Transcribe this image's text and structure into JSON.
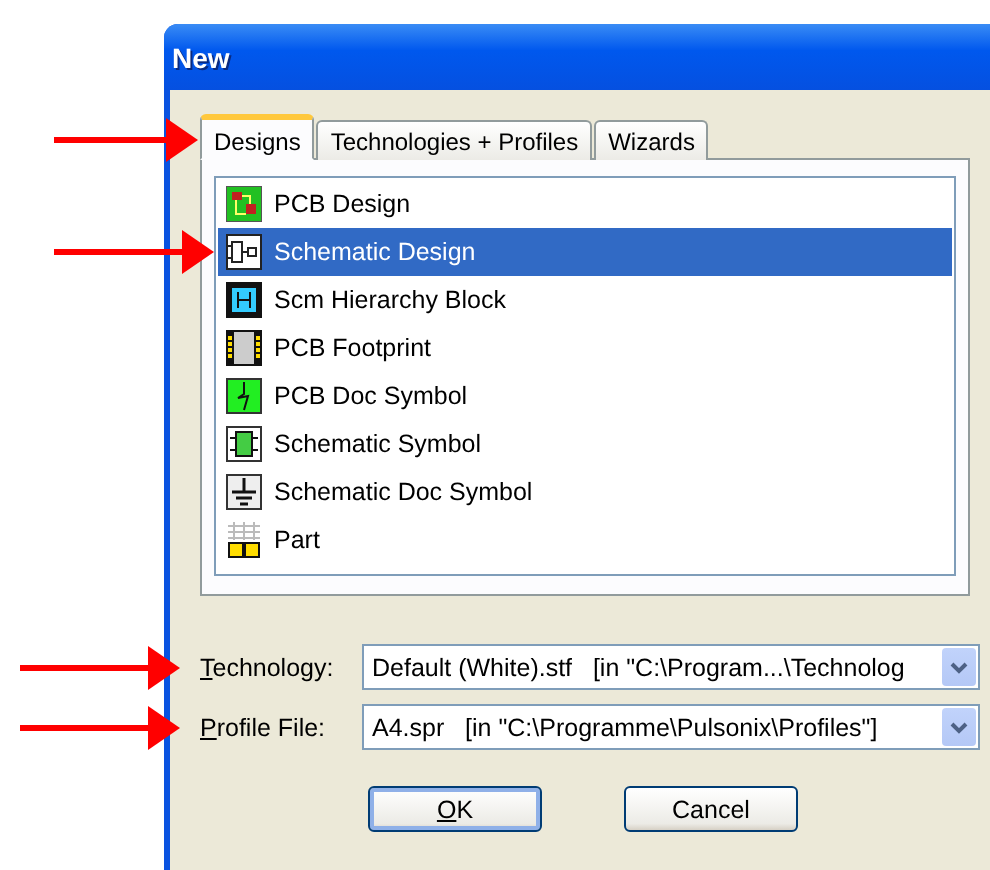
{
  "window": {
    "title": "New"
  },
  "tabs": [
    {
      "label": "Designs",
      "selected": true,
      "marked": true
    },
    {
      "label": "Technologies + Profiles",
      "selected": false,
      "marked": false
    },
    {
      "label": "Wizards",
      "selected": false,
      "marked": false
    }
  ],
  "items": [
    {
      "label": "PCB Design",
      "selected": false,
      "marked": false
    },
    {
      "label": "Schematic Design",
      "selected": true,
      "marked": true
    },
    {
      "label": "Scm Hierarchy Block",
      "selected": false,
      "marked": false
    },
    {
      "label": "PCB Footprint",
      "selected": false,
      "marked": false
    },
    {
      "label": "PCB Doc Symbol",
      "selected": false,
      "marked": false
    },
    {
      "label": "Schematic Symbol",
      "selected": false,
      "marked": false
    },
    {
      "label": "Schematic Doc Symbol",
      "selected": false,
      "marked": false
    },
    {
      "label": "Part",
      "selected": false,
      "marked": false
    }
  ],
  "fields": [
    {
      "label": "Technology:",
      "underline_first": true,
      "value": "Default (White).stf   [in \"C:\\Program...\\Technolog",
      "marked": true
    },
    {
      "label": "Profile File:",
      "underline_first": true,
      "value": "A4.spr   [in \"C:\\Programme\\Pulsonix\\Profiles\"]",
      "marked": true
    }
  ],
  "buttons": [
    {
      "label": "OK",
      "underline_first": true,
      "default": true
    },
    {
      "label": "Cancel",
      "underline_first": false,
      "default": false
    }
  ]
}
